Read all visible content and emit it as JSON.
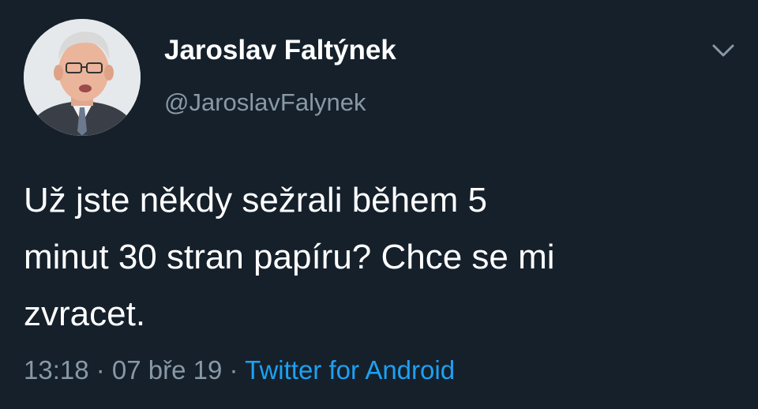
{
  "colors": {
    "background": "#15202b",
    "primary_text": "#ffffff",
    "secondary_text": "#8899a6",
    "link": "#1da1f2"
  },
  "tweet": {
    "author_name": "Jaroslav Faltýnek",
    "author_handle": "@JaroslavFalynek",
    "avatar_icon": "profile-photo",
    "menu_icon": "chevron-down-icon",
    "text_lines": [
      "Už jste někdy sežrali během 5",
      "minut 30 stran papíru? Chce se mi",
      "zvracet."
    ],
    "time": "13:18",
    "separator": " · ",
    "date": "07 bře 19",
    "source": "Twitter for Android"
  }
}
